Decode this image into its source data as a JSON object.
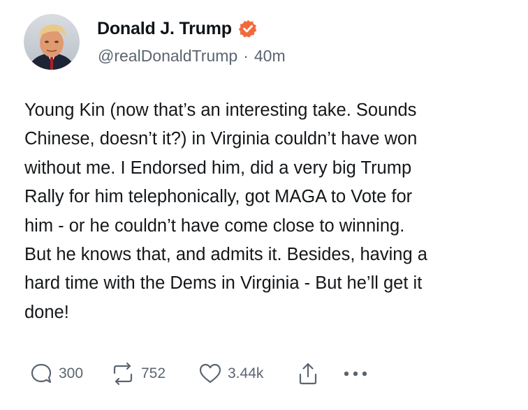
{
  "author": {
    "display_name": "Donald J. Trump",
    "handle": "@realDonaldTrump",
    "separator": "·",
    "time": "40m",
    "verified_icon": "verified-badge-icon",
    "verified_color": "#f26a3c"
  },
  "post": {
    "lines": [
      "Young Kin (now that’s an interesting take. Sounds",
      "Chinese, doesn’t it?) in Virginia couldn’t have won",
      "without me. I Endorsed him, did a very big Trump",
      "Rally for him telephonically, got MAGA to Vote for",
      "him - or he couldn’t have come close to winning.",
      "But he knows that, and admits it. Besides, having a",
      "hard time with the Dems in Virginia - But he’ll get it",
      "done!"
    ]
  },
  "actions": {
    "reply_count": "300",
    "repost_count": "752",
    "like_count": "3.44k",
    "icons": [
      "reply-icon",
      "repost-icon",
      "like-icon",
      "share-icon",
      "more-icon"
    ]
  }
}
